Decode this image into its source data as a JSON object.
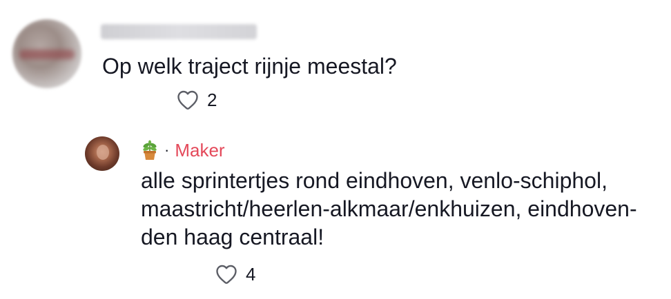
{
  "comments": [
    {
      "text": "Op welk traject rijnje meestal?",
      "likes": "2",
      "icons": {
        "like": "heart-outline-icon"
      }
    }
  ],
  "reply": {
    "badge_icon": "potted-plant-icon",
    "separator": "·",
    "author_label": "Maker",
    "author_label_color": "#e4495a",
    "text_lines": [
      "alle sprintertjes rond eindhoven, venlo-schiphol,",
      "maastricht/heerlen-alkmaar/enkhuizen, eindhoven-",
      "den haag centraal!"
    ],
    "likes": "4",
    "icons": {
      "like": "heart-outline-icon"
    }
  }
}
